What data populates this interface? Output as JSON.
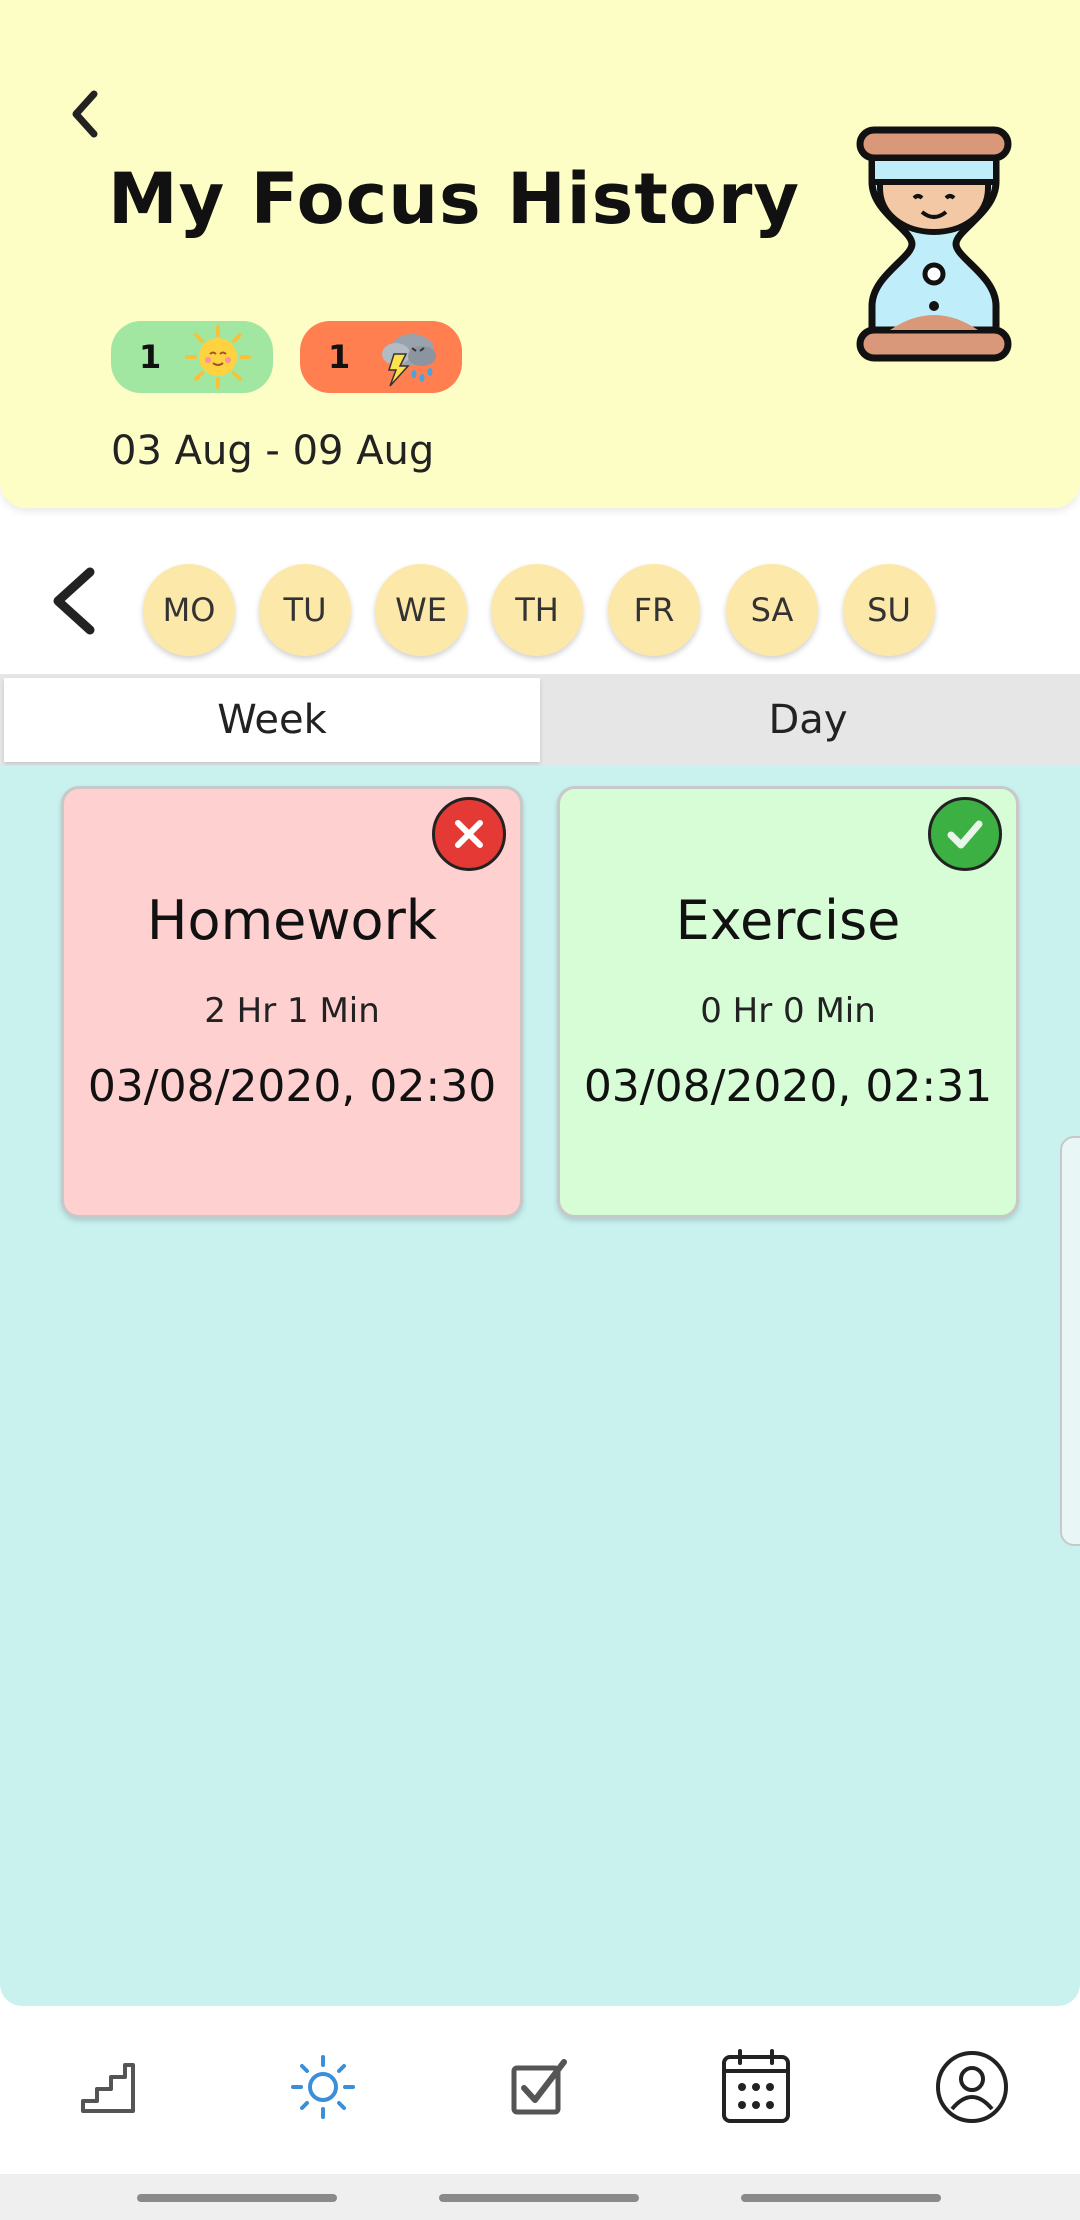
{
  "header": {
    "title": "My Focus History",
    "date_range": "03 Aug - 09 Aug",
    "badges": [
      {
        "count": "1",
        "icon": "sun-icon"
      },
      {
        "count": "1",
        "icon": "storm-cloud-icon"
      }
    ],
    "mascot": "hourglass-mascot-icon"
  },
  "days": [
    "MO",
    "TU",
    "WE",
    "TH",
    "FR",
    "SA",
    "SU"
  ],
  "tabs": [
    {
      "label": "Week",
      "active": true
    },
    {
      "label": "Day",
      "active": false
    }
  ],
  "sessions": [
    {
      "title": "Homework",
      "duration": "2 Hr 1 Min",
      "datetime": "03/08/2020, 02:30",
      "status": "failed",
      "color": "#ffd0d0",
      "status_color": "#e53935"
    },
    {
      "title": "Exercise",
      "duration": "0 Hr 0 Min",
      "datetime": "03/08/2020, 02:31",
      "status": "completed",
      "color": "#d6fdd6",
      "status_color": "#3cb043"
    }
  ],
  "bottom_nav": [
    {
      "icon": "stairs-icon",
      "active": false
    },
    {
      "icon": "sun-icon",
      "active": true
    },
    {
      "icon": "checkbox-icon",
      "active": false
    },
    {
      "icon": "calendar-icon",
      "active": false
    },
    {
      "icon": "profile-icon",
      "active": false
    }
  ],
  "colors": {
    "header_bg": "#fdfdc6",
    "content_bg": "#c9f2ef",
    "day_circle": "#fce8a9",
    "accent": "#3a8fd8"
  }
}
